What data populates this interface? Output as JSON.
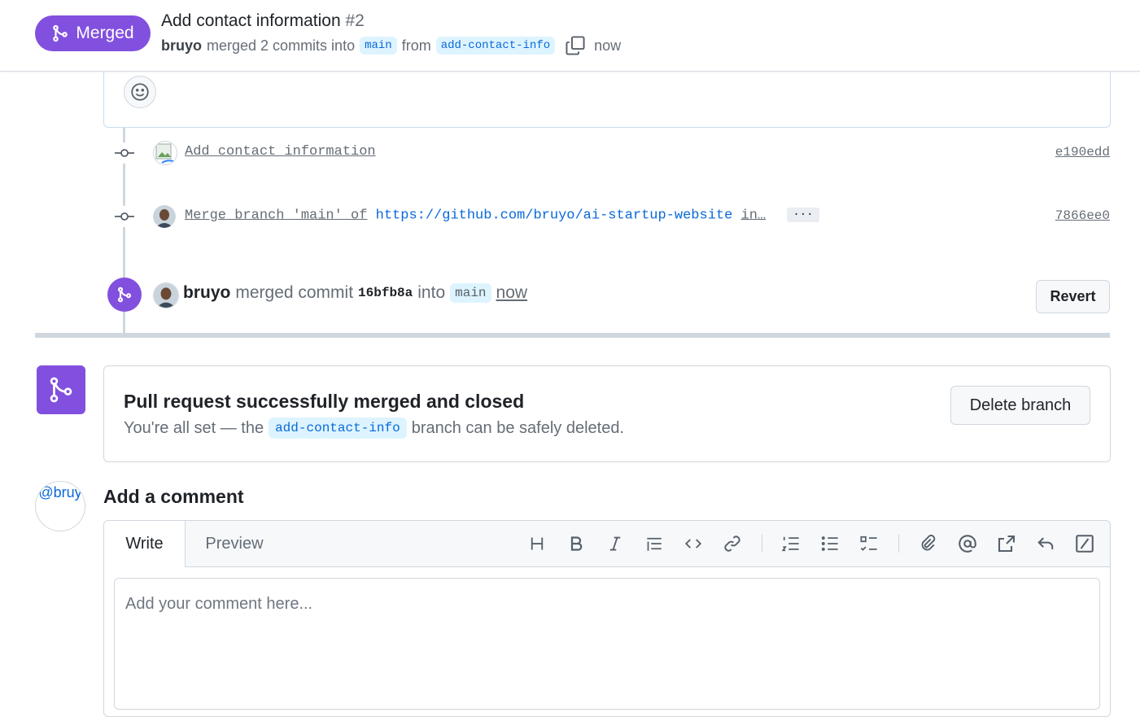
{
  "header": {
    "status_label": "Merged",
    "title": "Add contact information",
    "number": "#2",
    "author": "bruyo",
    "merged_text": "merged 2 commits into",
    "base_branch": "main",
    "from_text": "from",
    "head_branch": "add-contact-info",
    "time": "now"
  },
  "commits": [
    {
      "message": "Add contact information",
      "sha": "e190edd"
    },
    {
      "message_prefix": "Merge branch 'main' of",
      "link": "https://github.com/bruyo/ai-startup-website",
      "message_suffix": "in…",
      "more": "···",
      "sha": "7866ee0"
    }
  ],
  "merge_event": {
    "author": "bruyo",
    "text1": "merged commit",
    "sha": "16bfb8a",
    "text2": "into",
    "branch": "main",
    "time": "now",
    "revert_label": "Revert"
  },
  "merge_box": {
    "title": "Pull request successfully merged and closed",
    "sub_prefix": "You're all set — the",
    "branch": "add-contact-info",
    "sub_suffix": "branch can be safely deleted.",
    "delete_label": "Delete branch"
  },
  "comment": {
    "avatar_alt": "@bruy",
    "heading": "Add a comment",
    "tab_write": "Write",
    "tab_preview": "Preview",
    "placeholder": "Add your comment here..."
  },
  "toolbar": [
    "heading-icon",
    "bold-icon",
    "italic-icon",
    "quote-icon",
    "code-icon",
    "link-icon",
    "ordered-list-icon",
    "unordered-list-icon",
    "task-list-icon",
    "attach-icon",
    "mention-icon",
    "reference-icon",
    "reply-icon",
    "slash-command-icon"
  ],
  "colors": {
    "merged": "#8250df",
    "link": "#0969da",
    "branch_bg": "#ddf4ff"
  }
}
